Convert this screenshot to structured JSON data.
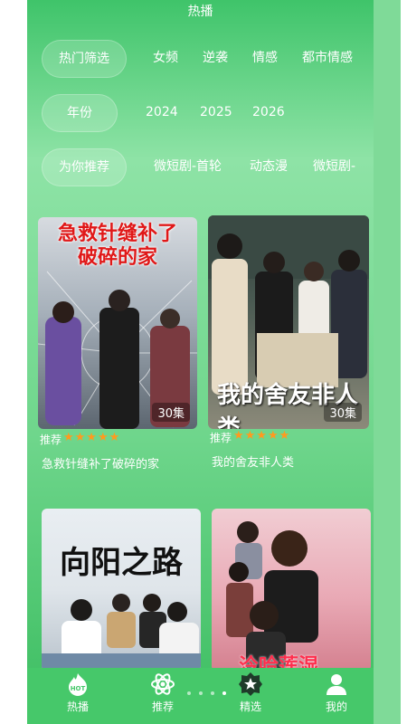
{
  "header": {
    "title": "热播"
  },
  "filters": [
    {
      "label": "热门筛选",
      "options": [
        "女频",
        "逆袭",
        "情感",
        "都市情感"
      ]
    },
    {
      "label": "年份",
      "options": [
        "2024",
        "2025",
        "2026"
      ]
    },
    {
      "label": "为你推荐",
      "options": [
        "微短剧-首轮",
        "动态漫",
        "微短剧-"
      ]
    }
  ],
  "cards": [
    {
      "poster_text": "急救针缝补了破碎的家",
      "poster_line1": "急救针缝补了",
      "poster_line2": "破碎的家",
      "episodes": "30集",
      "rec_label": "推荐",
      "stars": "★★★★★",
      "title": "急救针缝补了破碎的家"
    },
    {
      "poster_text": "我的舍友非人类",
      "episodes": "30集",
      "rec_label": "推荐",
      "stars": "★★★★★",
      "title": "我的舍友非人类"
    },
    {
      "poster_text": "向阳之路"
    },
    {
      "poster_text": "泠哈莲湿"
    }
  ],
  "tabbar": {
    "items": [
      {
        "label": "热播",
        "icon": "hot-icon",
        "badge": "HOT"
      },
      {
        "label": "推荐",
        "icon": "atom-icon"
      },
      {
        "label": "精选",
        "icon": "star-badge-icon"
      },
      {
        "label": "我的",
        "icon": "user-icon"
      }
    ],
    "pager": {
      "count": 4,
      "active": 3
    }
  },
  "colors": {
    "accent": "#3fc46a",
    "star": "#ff9a1f",
    "poster_title_red": "#e01818"
  }
}
